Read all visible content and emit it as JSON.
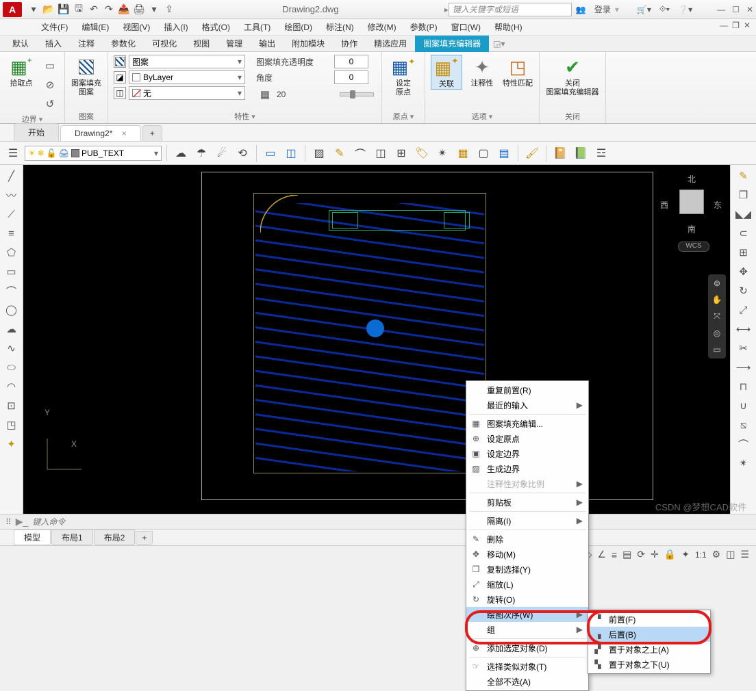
{
  "title": "Drawing2.dwg",
  "search_placeholder": "键入关键字或短语",
  "login": "登录",
  "menus": [
    "文件(F)",
    "编辑(E)",
    "视图(V)",
    "插入(I)",
    "格式(O)",
    "工具(T)",
    "绘图(D)",
    "标注(N)",
    "修改(M)",
    "参数(P)",
    "窗口(W)",
    "帮助(H)"
  ],
  "ribbon_tabs": [
    "默认",
    "插入",
    "注释",
    "参数化",
    "可视化",
    "视图",
    "管理",
    "输出",
    "附加模块",
    "协作",
    "精选应用",
    "图案填充编辑器"
  ],
  "ribbon": {
    "boundary": {
      "pick": "拾取点",
      "title": "边界"
    },
    "pattern": {
      "btn": "图案填充\n图案",
      "title": "图案"
    },
    "props": {
      "type_label": "图案",
      "bylayer": "ByLayer",
      "none": "无",
      "trans_label": "图案填充透明度",
      "trans_val": "0",
      "angle_label": "角度",
      "angle_val": "0",
      "scale_val": "20",
      "title": "特性"
    },
    "origin": {
      "btn": "设定\n原点",
      "title": "原点"
    },
    "options": {
      "assoc": "关联",
      "annot": "注释性",
      "match": "特性匹配",
      "title": "选项"
    },
    "close": {
      "btn": "关闭\n图案填充编辑器",
      "title": "关闭"
    }
  },
  "doc_tabs": {
    "start": "开始",
    "drawing": "Drawing2*"
  },
  "layer": "PUB_TEXT",
  "compass": {
    "n": "北",
    "s": "南",
    "e": "东",
    "w": "西"
  },
  "wcs": "WCS",
  "context_menu": [
    {
      "icon": "",
      "label": "重复前置(R)"
    },
    {
      "icon": "",
      "label": "最近的输入",
      "sub": true
    },
    {
      "sep": true
    },
    {
      "icon": "▦",
      "label": "图案填充编辑..."
    },
    {
      "icon": "⊕",
      "label": "设定原点"
    },
    {
      "icon": "▣",
      "label": "设定边界"
    },
    {
      "icon": "▨",
      "label": "生成边界"
    },
    {
      "icon": "",
      "label": "注释性对象比例",
      "sub": true,
      "dis": true
    },
    {
      "sep": true
    },
    {
      "icon": "",
      "label": "剪贴板",
      "sub": true
    },
    {
      "sep": true
    },
    {
      "icon": "",
      "label": "隔离(I)",
      "sub": true
    },
    {
      "sep": true
    },
    {
      "icon": "✎",
      "label": "删除"
    },
    {
      "icon": "✥",
      "label": "移动(M)"
    },
    {
      "icon": "❐",
      "label": "复制选择(Y)"
    },
    {
      "icon": "⤢",
      "label": "缩放(L)"
    },
    {
      "icon": "↻",
      "label": "旋转(O)"
    },
    {
      "icon": "",
      "label": "绘图次序(W)",
      "sub": true,
      "hl": true
    },
    {
      "icon": "",
      "label": "组",
      "sub": true
    },
    {
      "sep": true
    },
    {
      "icon": "⊕",
      "label": "添加选定对象(D)"
    },
    {
      "sep": true
    },
    {
      "icon": "☞",
      "label": "选择类似对象(T)"
    },
    {
      "icon": "",
      "label": "全部不选(A)"
    }
  ],
  "submenu": [
    {
      "icon": "▝",
      "label": "前置(F)"
    },
    {
      "icon": "▗",
      "label": "后置(B)",
      "hl": true
    },
    {
      "icon": "▞",
      "label": "置于对象之上(A)"
    },
    {
      "icon": "▚",
      "label": "置于对象之下(U)"
    }
  ],
  "cmd_placeholder": "键入命令",
  "model_tabs": [
    "模型",
    "布局1",
    "布局2"
  ],
  "status": {
    "model": "模型",
    "scale": "1:1"
  },
  "watermark": "CSDN @梦想CAD软件"
}
